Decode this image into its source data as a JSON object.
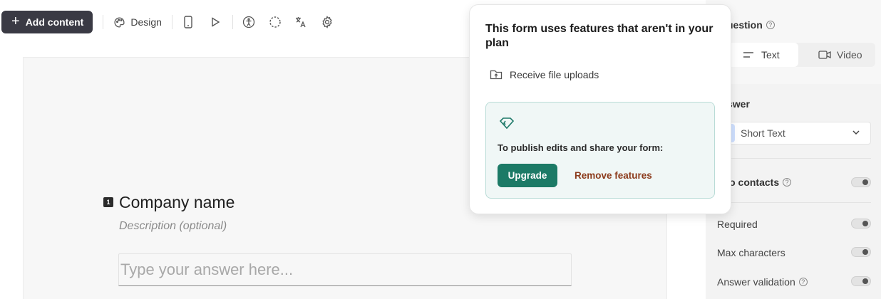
{
  "toolbar": {
    "add_content_label": "Add content",
    "design_label": "Design",
    "icons": [
      "mobile-preview-icon",
      "play-preview-icon",
      "accessibility-icon",
      "loading-icon",
      "translate-icon",
      "settings-icon"
    ]
  },
  "question": {
    "number": "1",
    "title": "Company name",
    "description_placeholder": "Description (optional)",
    "answer_placeholder": "Type your answer here..."
  },
  "panel": {
    "question_label": "uestion",
    "tabs": [
      {
        "label": "Text",
        "icon": "text-lines-icon"
      },
      {
        "label": "Video",
        "icon": "video-icon"
      }
    ],
    "answer_label": "swer",
    "answer_type": "Short Text",
    "map_contacts_label": "p to contacts",
    "required_label": "Required",
    "max_characters_label": "Max characters",
    "answer_validation_label": "Answer validation"
  },
  "popup": {
    "title": "This form uses features that aren't in your plan",
    "feature": "Receive file uploads",
    "publish_text": "To publish edits and share your form:",
    "upgrade_label": "Upgrade",
    "remove_label": "Remove features"
  },
  "colors": {
    "upgrade_button": "#1c7a66",
    "remove_link": "#8c3b1c",
    "upgrade_box_bg": "#f0f7f6",
    "add_content_bg": "#3a3a44"
  }
}
